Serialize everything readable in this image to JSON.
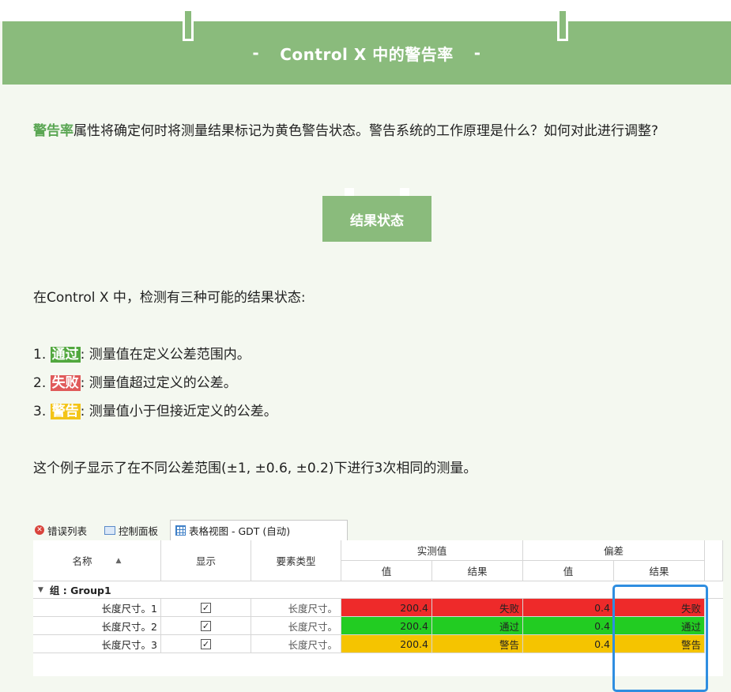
{
  "banner": {
    "title": "Control X 中的警告率",
    "dash_left": "-",
    "dash_right": "-"
  },
  "intro": {
    "highlight": "警告率",
    "text": "属性将确定何时将测量结果标记为黄色警告状态。警告系统的工作原理是什么？如何对此进行调整?"
  },
  "section": {
    "title": "结果状态"
  },
  "states_intro": "在Control X 中，检测有三种可能的结果状态:",
  "states": [
    {
      "num": "1.",
      "tag": "通过",
      "desc": ": 测量值在定义公差范围内。"
    },
    {
      "num": "2.",
      "tag": "失败",
      "desc": ": 测量值超过定义的公差。"
    },
    {
      "num": "3.",
      "tag": "警告",
      "desc": ": 测量值小于但接近定义的公差。"
    }
  ],
  "example_text": "这个例子显示了在不同公差范围(±1, ±0.6, ±0.2)下进行3次相同的测量。",
  "screenshot": {
    "tabs": {
      "errors": "错误列表",
      "control_panel": "控制面板",
      "table_view": "表格视图 - GDT (自动)"
    },
    "headers": {
      "name": "名称",
      "sort_arrow": "▲",
      "display": "显示",
      "feature_type": "要素类型",
      "measured": "实测值",
      "deviation": "偏差",
      "value": "值",
      "result": "结果"
    },
    "group": {
      "toggle": "▼",
      "label": "组 : Group1"
    },
    "rows": [
      {
        "name": "长度尺寸。1",
        "check": "✓",
        "type": "长度尺寸。",
        "measured_value": "200.4",
        "measured_result": "失败",
        "dev_value": "0.4",
        "dev_result": "失败",
        "status": "fail"
      },
      {
        "name": "长度尺寸。2",
        "check": "✓",
        "type": "长度尺寸。",
        "measured_value": "200.4",
        "measured_result": "通过",
        "dev_value": "0.4",
        "dev_result": "通过",
        "status": "pass"
      },
      {
        "name": "长度尺寸。3",
        "check": "✓",
        "type": "长度尺寸。",
        "measured_value": "200.4",
        "measured_result": "警告",
        "dev_value": "0.4",
        "dev_result": "警告",
        "status": "warn"
      }
    ]
  },
  "colors": {
    "banner": "#8abb7c",
    "highlight_text": "#5aa653",
    "fail": "#ee2a2a",
    "pass": "#22cc22",
    "warn": "#f5c400",
    "callout_border": "#2f8ee0"
  }
}
